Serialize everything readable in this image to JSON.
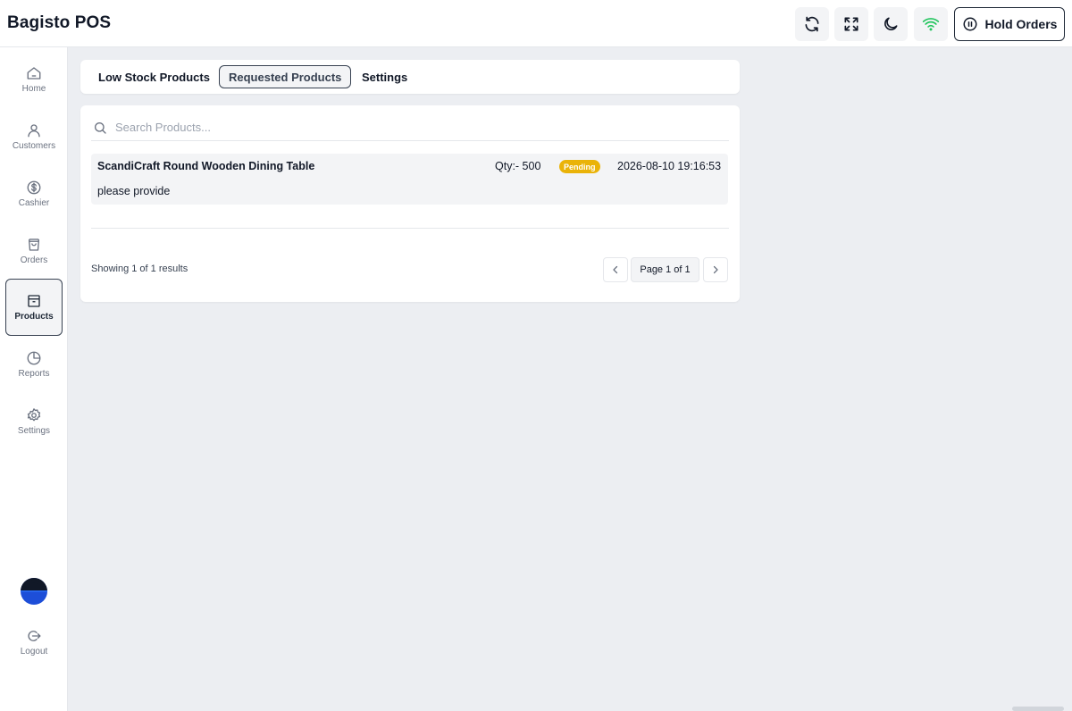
{
  "header": {
    "brand": "Bagisto POS",
    "hold_orders_label": "Hold Orders",
    "colors": {
      "wifi": "#22c55e"
    }
  },
  "sidebar": {
    "items": [
      {
        "label": "Home",
        "icon": "home-icon"
      },
      {
        "label": "Customers",
        "icon": "user-icon"
      },
      {
        "label": "Cashier",
        "icon": "dollar-icon"
      },
      {
        "label": "Orders",
        "icon": "bag-icon"
      },
      {
        "label": "Products",
        "icon": "box-icon",
        "active": true
      },
      {
        "label": "Reports",
        "icon": "pie-chart-icon"
      },
      {
        "label": "Settings",
        "icon": "gear-icon"
      }
    ],
    "logout_label": "Logout"
  },
  "tabs": [
    {
      "label": "Low Stock Products"
    },
    {
      "label": "Requested Products",
      "active": true
    },
    {
      "label": "Settings"
    }
  ],
  "search": {
    "placeholder": "Search Products..."
  },
  "requests": [
    {
      "product": "ScandiCraft Round Wooden Dining Table",
      "qty": "Qty:- 500",
      "status": "Pending",
      "status_color": "#eab308",
      "date": "2026-08-10 19:16:53",
      "note": "please provide"
    }
  ],
  "pagination": {
    "showing": "Showing 1 of 1 results",
    "page": "Page 1 of 1"
  }
}
